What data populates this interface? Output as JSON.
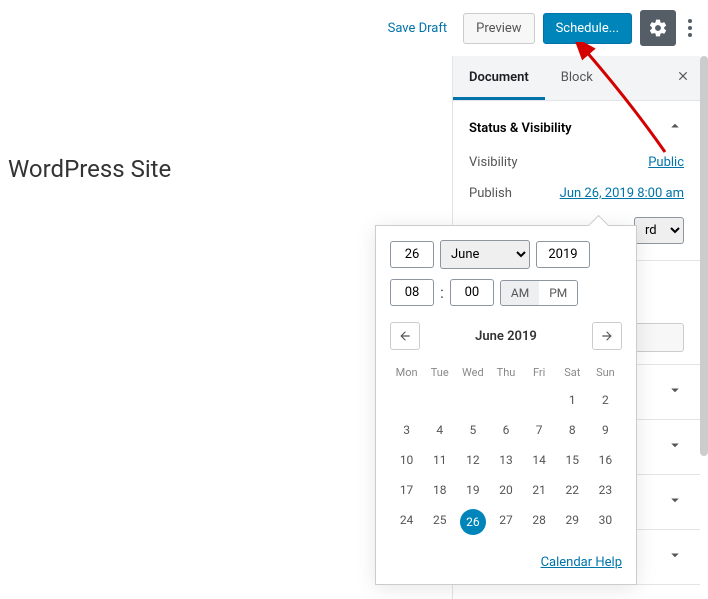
{
  "topbar": {
    "saveDraft": "Save Draft",
    "preview": "Preview",
    "schedule": "Schedule..."
  },
  "title": "WordPress Site",
  "tabs": {
    "document": "Document",
    "block": "Block"
  },
  "status": {
    "heading": "Status & Visibility",
    "visibilityLabel": "Visibility",
    "visibilityValue": "Public",
    "publishLabel": "Publish",
    "publishValue": "Jun 26, 2019 8:00 am",
    "formatValue": "rd"
  },
  "datepicker": {
    "day": "26",
    "month": "June",
    "year": "2019",
    "hour": "08",
    "minute": "00",
    "am": "AM",
    "pm": "PM",
    "calTitle": "June 2019",
    "dows": [
      "Mon",
      "Tue",
      "Wed",
      "Thu",
      "Fri",
      "Sat",
      "Sun"
    ],
    "blanks": 5,
    "selected": 26,
    "lastDay": 30,
    "help": "Calendar Help"
  }
}
